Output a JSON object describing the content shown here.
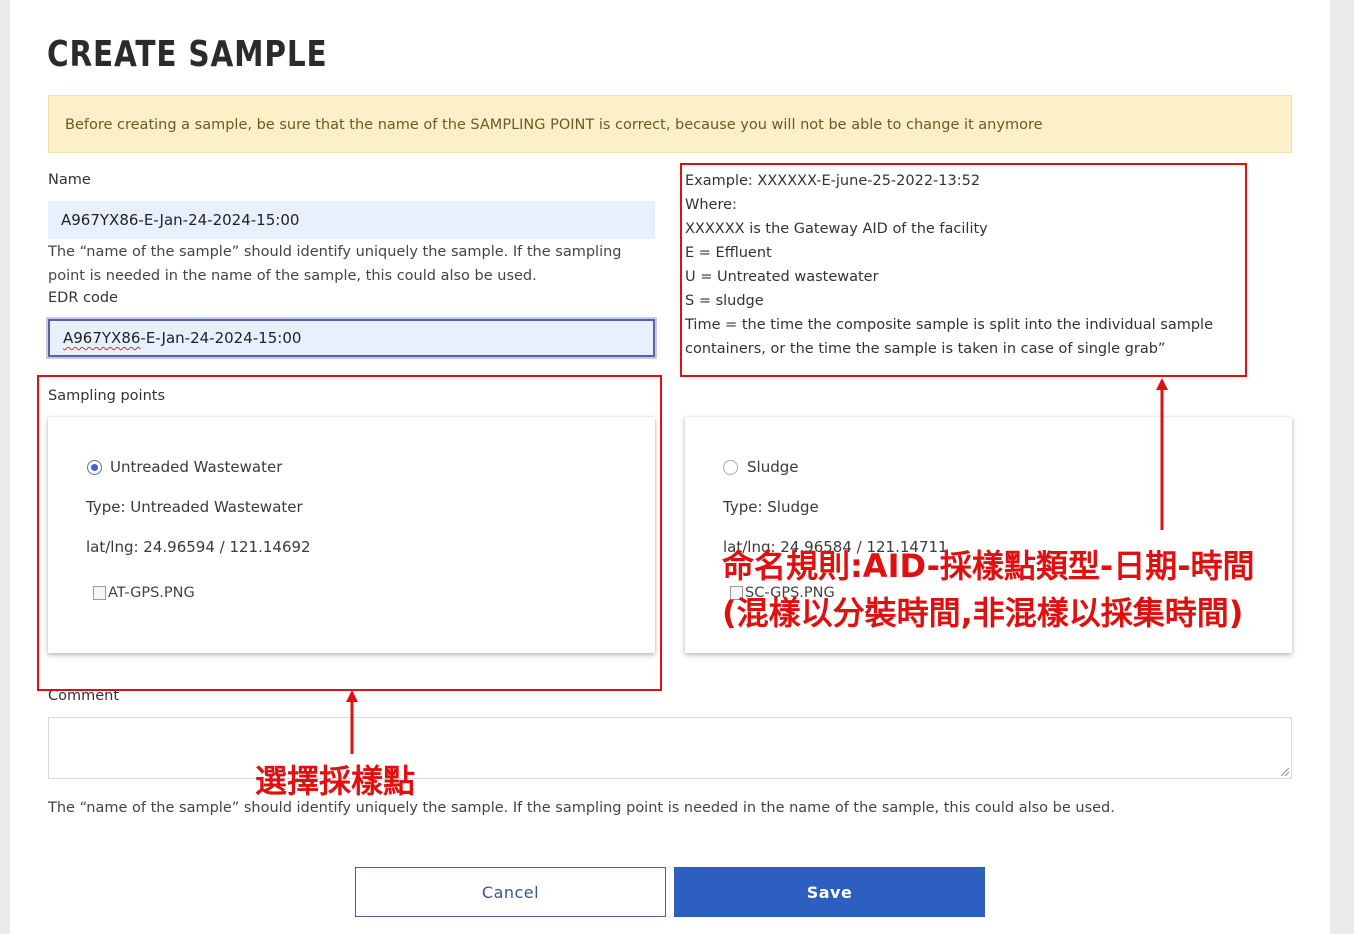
{
  "page": {
    "title": "CREATE SAMPLE",
    "alert": "Before creating a sample, be sure that the name of the SAMPLING POINT is correct, because you will not be able to change it anymore"
  },
  "form": {
    "name_label": "Name",
    "name_value": "A967YX86-E-Jan-24-2024-15:00",
    "name_help_line1": "The “name of the sample” should identify uniquely the sample. If the sampling",
    "name_help_line2": "point is needed in the name of the sample, this could also be used.",
    "edr_label": "EDR code",
    "edr_value_prefix": "A967YX86",
    "edr_value_rest": "-E-Jan-24-2024-15:00",
    "sampling_points_label": "Sampling points",
    "comment_label": "Comment",
    "comment_value": "",
    "bottom_help": "The “name of the sample” should identify uniquely the sample. If the sampling point is needed in the name of the sample, this could also be used."
  },
  "example": {
    "lines": [
      "Example: XXXXXX-E-june-25-2022-13:52",
      "Where:",
      "XXXXXX is the Gateway AID of the facility",
      "E = Effluent",
      "U = Untreated wastewater",
      "S = sludge",
      "Time = the time the composite sample is split into the individual sample",
      "containers, or the time the sample is taken in case of single grab”"
    ]
  },
  "sampling_points": [
    {
      "name": "Untreaded Wastewater",
      "type": "Type: Untreaded Wastewater",
      "coords": "lat/lng: 24.96594 / 121.14692",
      "image_alt": "AT-GPS.PNG",
      "selected": true
    },
    {
      "name": "Sludge",
      "type": "Type: Sludge",
      "coords": "lat/lng: 24.96584 / 121.14711",
      "image_alt": "SC-GPS.PNG",
      "selected": false
    }
  ],
  "buttons": {
    "cancel": "Cancel",
    "save": "Save"
  },
  "annotations": {
    "naming_rule_line1": "命名規則:AID-採樣點類型-日期-時間",
    "naming_rule_line2": "(混樣以分裝時間,非混樣以採集時間)",
    "select_point": "選擇採樣點",
    "color": "#e01010"
  },
  "colors": {
    "alert_bg": "#fcf0c8",
    "save_button": "#2c5fbf",
    "input_bg": "#e8f0fe"
  }
}
